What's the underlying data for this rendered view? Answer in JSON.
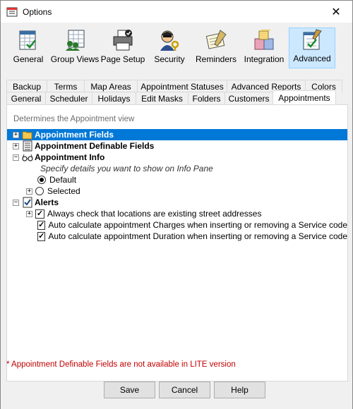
{
  "window": {
    "title": "Options",
    "close_glyph": "✕"
  },
  "toolbar": [
    {
      "label": "General",
      "icon": "general-icon"
    },
    {
      "label": "Group Views",
      "icon": "group-views-icon"
    },
    {
      "label": "Page Setup",
      "icon": "printer-icon"
    },
    {
      "label": "Security",
      "icon": "security-icon"
    },
    {
      "label": "Reminders",
      "icon": "reminders-icon"
    },
    {
      "label": "Integration",
      "icon": "integration-icon"
    },
    {
      "label": "Advanced",
      "icon": "advanced-icon",
      "active": true
    }
  ],
  "tabs": {
    "row1": [
      "Backup",
      "Terms",
      "Map Areas",
      "Appointment Statuses",
      "Advanced Reports",
      "Colors"
    ],
    "row2": [
      "General",
      "Scheduler",
      "Holidays",
      "Edit Masks",
      "Folders",
      "Customers",
      "Appointments"
    ],
    "selected": "Appointments"
  },
  "panel": {
    "description": "Determines the Appointment view",
    "tree": {
      "appointment_fields": "Appointment Fields",
      "appointment_definable_fields": "Appointment Definable Fields",
      "appointment_info": "Appointment Info",
      "info_hint": "Specify details you want to show on Info Pane",
      "option_default": "Default",
      "option_selected": "Selected",
      "alerts": "Alerts",
      "alert_1": "Always check that locations are existing street addresses",
      "alert_2": "Auto calculate appointment Charges when inserting or removing a Service code",
      "alert_3": "Auto calculate appointment Duration when inserting or removing a Service code"
    },
    "footnote": "* Appointment Definable Fields are not available in LITE version"
  },
  "buttons": {
    "save": "Save",
    "cancel": "Cancel",
    "help": "Help"
  },
  "colors": {
    "highlight": "#0078d7",
    "footnote": "#c00000",
    "active_tool": "#cce8ff"
  }
}
